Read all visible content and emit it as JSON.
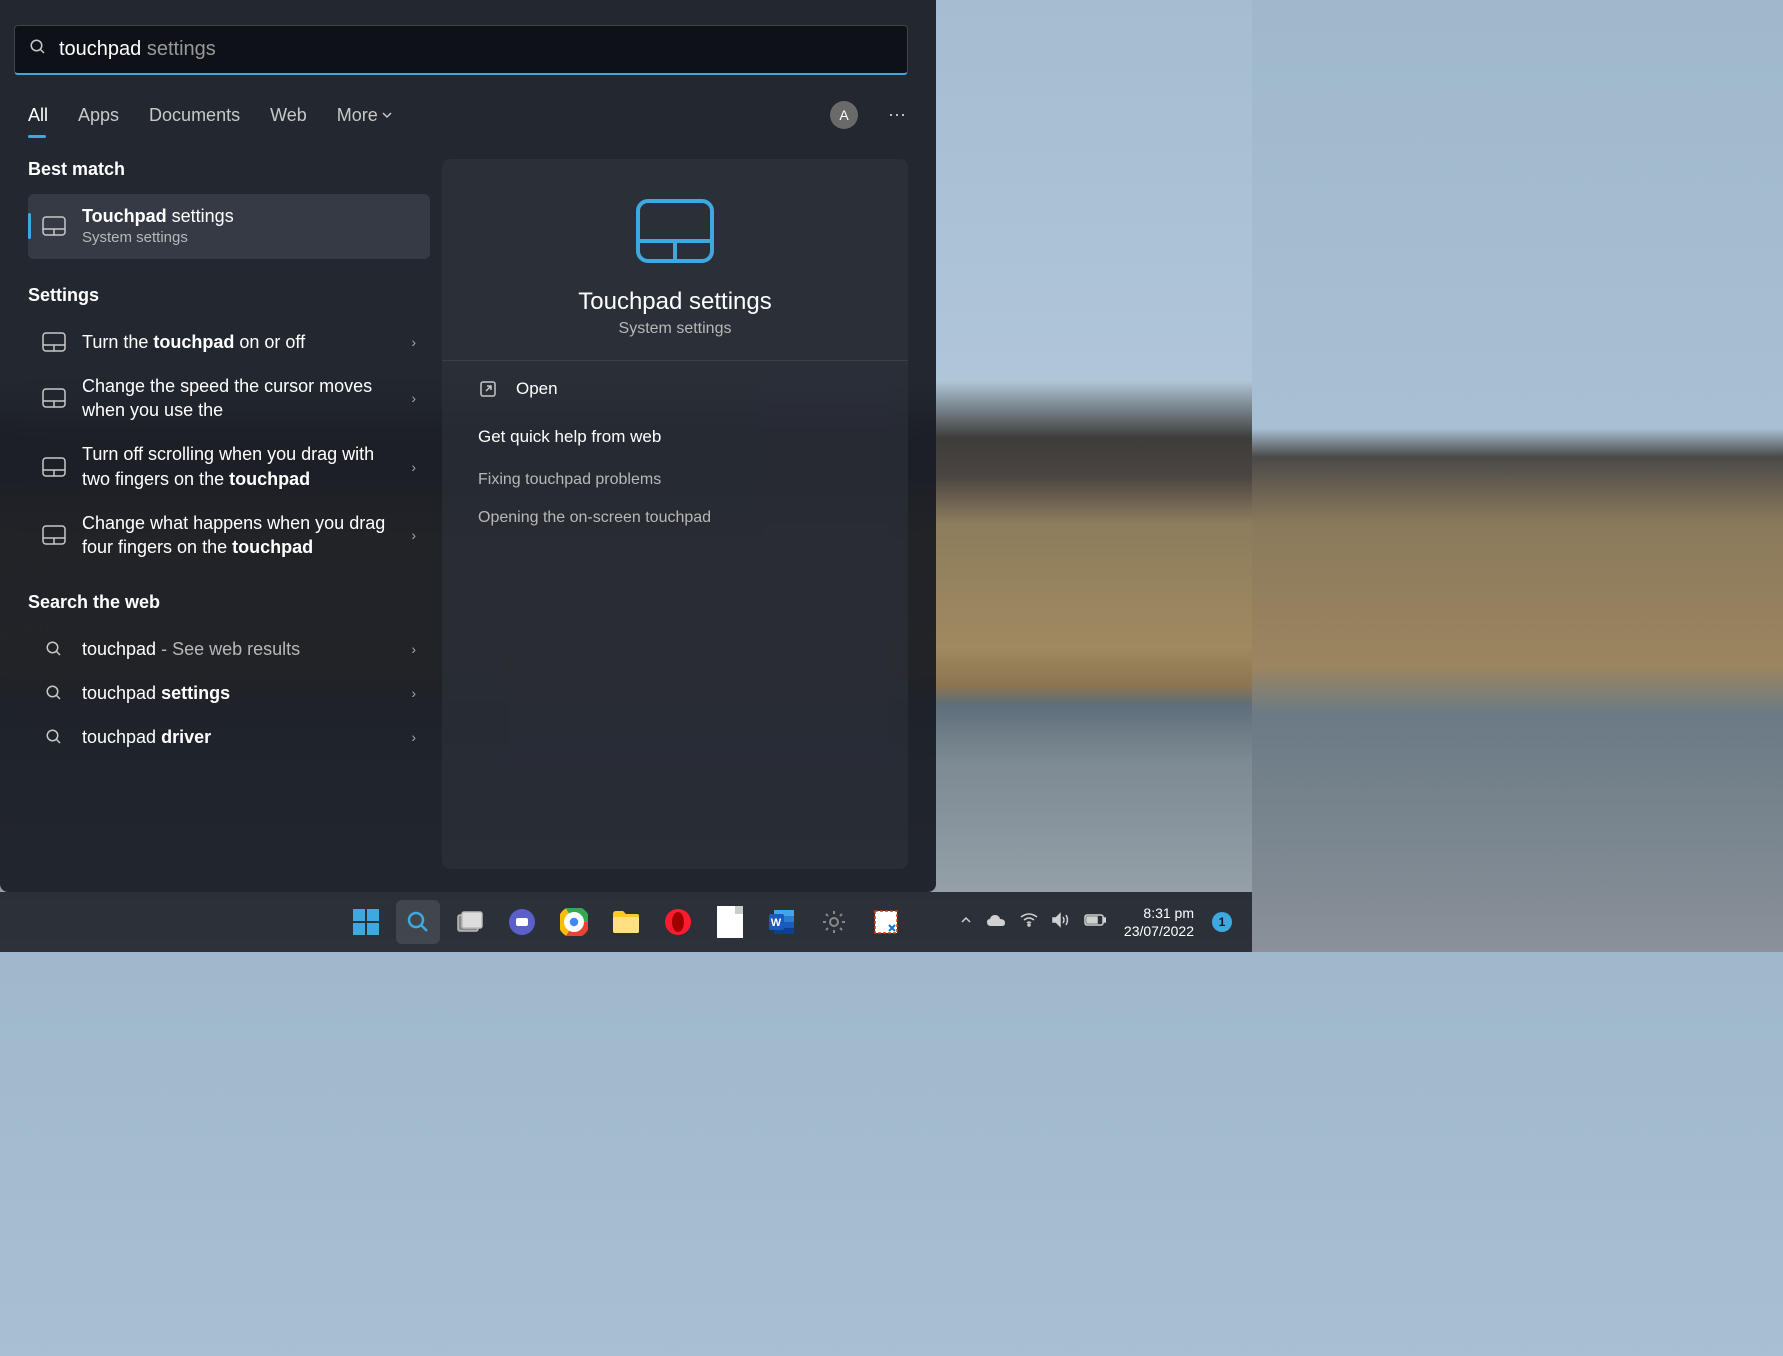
{
  "search": {
    "typed": "touchpad",
    "suggestion": " settings"
  },
  "tabs": [
    "All",
    "Apps",
    "Documents",
    "Web",
    "More"
  ],
  "avatar_letter": "A",
  "sections": {
    "best_match": "Best match",
    "settings": "Settings",
    "web": "Search the web"
  },
  "best_match": {
    "title_bold": "Touchpad",
    "title_rest": " settings",
    "subtitle": "System settings"
  },
  "settings_results": [
    {
      "pre": "Turn the ",
      "bold": "touchpad",
      "post": " on or off"
    },
    {
      "pre": "Change the speed the cursor moves when you use the",
      "bold": "",
      "post": ""
    },
    {
      "pre": "Turn off scrolling when you drag with two fingers on the ",
      "bold": "touchpad",
      "post": ""
    },
    {
      "pre": "Change what happens when you drag four fingers on the ",
      "bold": "touchpad",
      "post": ""
    }
  ],
  "web_results": [
    {
      "term": "touchpad",
      "rest": " - See web results"
    },
    {
      "term": "touchpad ",
      "bold": "settings"
    },
    {
      "term": "touchpad ",
      "bold": "driver"
    }
  ],
  "preview": {
    "title": "Touchpad settings",
    "subtitle": "System settings",
    "open": "Open",
    "help_header": "Get quick help from web",
    "help_links": [
      "Fixing touchpad problems",
      "Opening the on-screen touchpad"
    ]
  },
  "taskbar": {
    "time": "8:31 pm",
    "date": "23/07/2022",
    "notif_count": "1"
  }
}
